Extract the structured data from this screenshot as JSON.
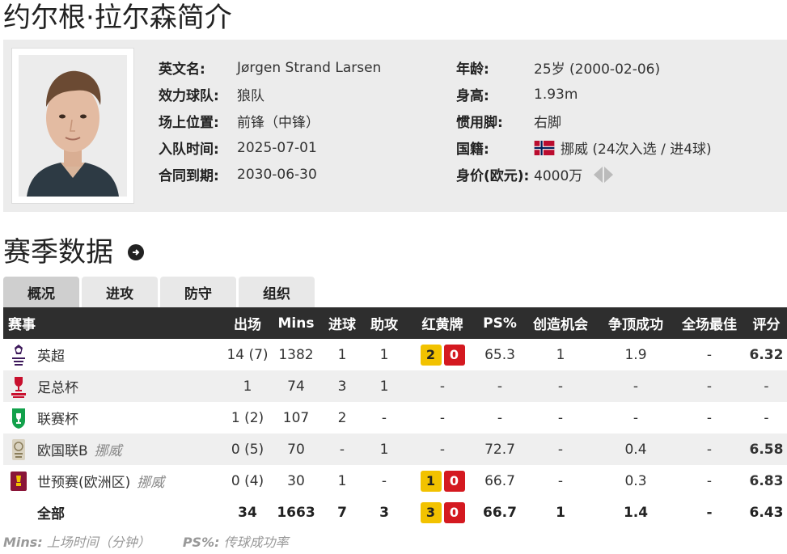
{
  "page_title": "约尔根·拉尔森简介",
  "profile": {
    "left": [
      {
        "label": "英文名:",
        "value": "Jørgen Strand Larsen"
      },
      {
        "label": "效力球队:",
        "value": "狼队"
      },
      {
        "label": "场上位置:",
        "value": "前锋（中锋）"
      },
      {
        "label": "入队时间:",
        "value": "2025-07-01"
      },
      {
        "label": "合同到期:",
        "value": "2030-06-30"
      }
    ],
    "right": [
      {
        "label": "年龄:",
        "value": "25岁  (2000-02-06)"
      },
      {
        "label": "身高:",
        "value": "1.93m"
      },
      {
        "label": "惯用脚:",
        "value": "右脚"
      },
      {
        "label": "国籍:",
        "value": "挪威 (24次入选 / 进4球)"
      },
      {
        "label": "身价(欧元):",
        "value": "4000万"
      }
    ]
  },
  "section_title": "赛季数据",
  "tabs": [
    "概况",
    "进攻",
    "防守",
    "组织"
  ],
  "table": {
    "headers": [
      "赛事",
      "出场",
      "Mins",
      "进球",
      "助攻",
      "红黄牌",
      "PS%",
      "创造机会",
      "争顶成功",
      "全场最佳",
      "评分"
    ],
    "rows": [
      {
        "comp": "英超",
        "team": "",
        "apps": "14 (7)",
        "mins": "1382",
        "goals": "1",
        "assists": "1",
        "yellow": "2",
        "red": "0",
        "cards": "",
        "ps": "65.3",
        "chances": "1",
        "aerials": "1.9",
        "motm": "-",
        "rating": "6.32"
      },
      {
        "comp": "足总杯",
        "team": "",
        "apps": "1",
        "mins": "74",
        "goals": "3",
        "assists": "1",
        "yellow": "",
        "red": "",
        "cards": "-",
        "ps": "-",
        "chances": "-",
        "aerials": "-",
        "motm": "-",
        "rating": "-"
      },
      {
        "comp": "联赛杯",
        "team": "",
        "apps": "1 (2)",
        "mins": "107",
        "goals": "2",
        "assists": "-",
        "yellow": "",
        "red": "",
        "cards": "-",
        "ps": "-",
        "chances": "-",
        "aerials": "-",
        "motm": "-",
        "rating": "-"
      },
      {
        "comp": "欧国联B",
        "team": "挪威",
        "apps": "0 (5)",
        "mins": "70",
        "goals": "-",
        "assists": "1",
        "yellow": "",
        "red": "",
        "cards": "-",
        "ps": "72.7",
        "chances": "-",
        "aerials": "0.4",
        "motm": "-",
        "rating": "6.58"
      },
      {
        "comp": "世预赛(欧洲区)",
        "team": "挪威",
        "apps": "0 (4)",
        "mins": "30",
        "goals": "1",
        "assists": "-",
        "yellow": "1",
        "red": "0",
        "cards": "",
        "ps": "66.7",
        "chances": "-",
        "aerials": "0.3",
        "motm": "-",
        "rating": "6.83"
      }
    ],
    "total": {
      "comp": "全部",
      "apps": "34",
      "mins": "1663",
      "goals": "7",
      "assists": "3",
      "yellow": "3",
      "red": "0",
      "ps": "66.7",
      "chances": "1",
      "aerials": "1.4",
      "motm": "-",
      "rating": "6.43"
    }
  },
  "footnote": {
    "mins_key": "Mins:",
    "mins_desc": " 上场时间（分钟）",
    "ps_key": "PS%:",
    "ps_desc": " 传球成功率"
  },
  "colors": {
    "rating": "#e06a1b",
    "yellow_card": "#f2c200",
    "red_card": "#d41920",
    "header_bg": "#2e2e2e"
  },
  "icons": {
    "logos": [
      "premier-league-logo",
      "fa-cup-logo",
      "carabao-cup-logo",
      "nations-league-logo",
      "world-cup-qualifier-logo"
    ]
  }
}
